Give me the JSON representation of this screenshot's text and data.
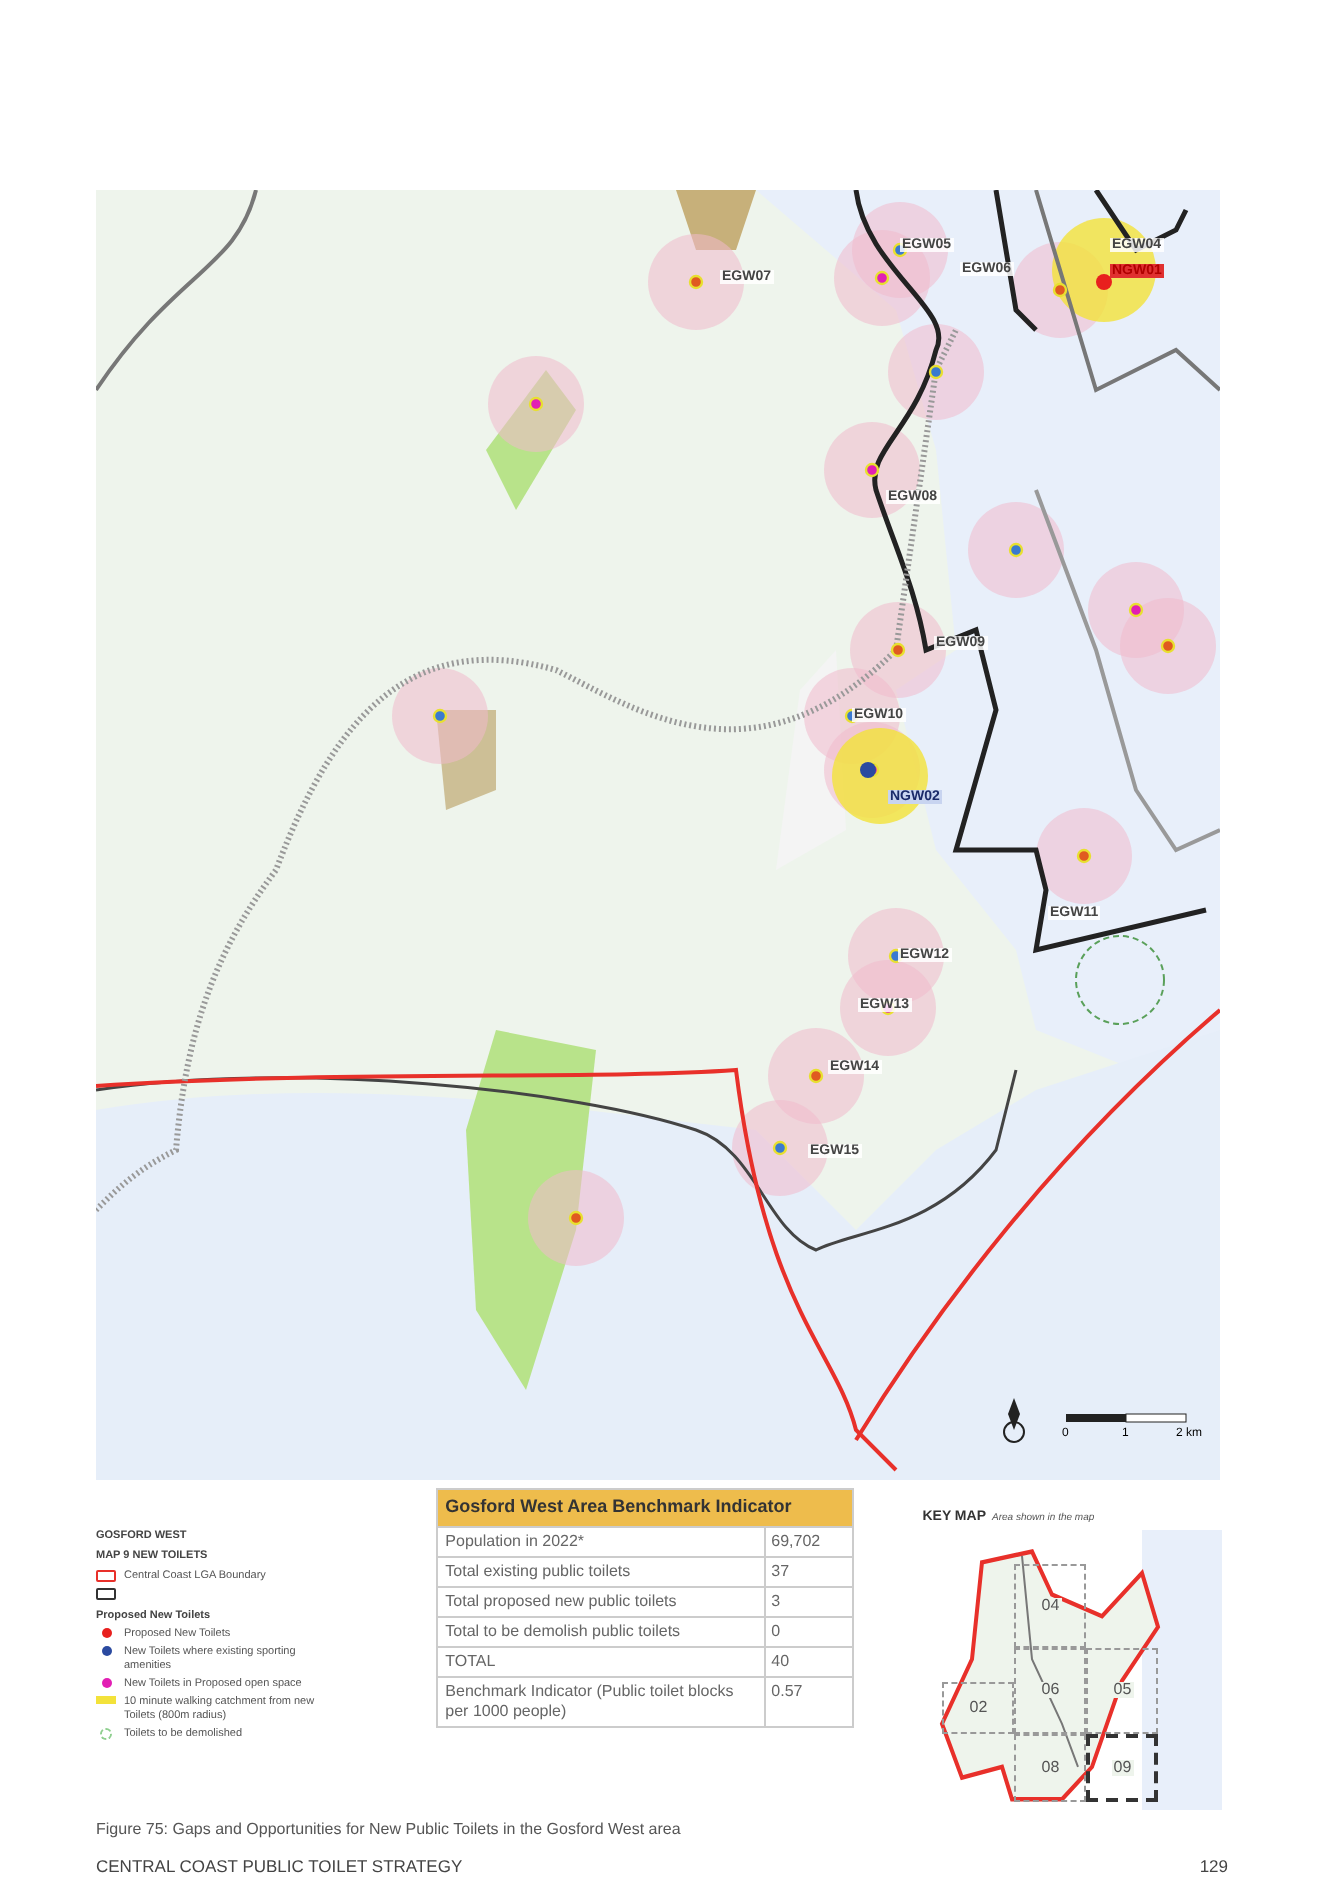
{
  "map": {
    "labels": [
      {
        "text": "EGW07",
        "kind": "existing"
      },
      {
        "text": "EGW05",
        "kind": "existing"
      },
      {
        "text": "EGW06",
        "kind": "existing"
      },
      {
        "text": "EGW04",
        "kind": "existing"
      },
      {
        "text": "NGW01",
        "kind": "new-red"
      },
      {
        "text": "EGW08",
        "kind": "existing"
      },
      {
        "text": "EGW09",
        "kind": "existing"
      },
      {
        "text": "EGW10",
        "kind": "existing"
      },
      {
        "text": "NGW02",
        "kind": "new-blue"
      },
      {
        "text": "EGW11",
        "kind": "existing"
      },
      {
        "text": "EGW12",
        "kind": "existing"
      },
      {
        "text": "EGW13",
        "kind": "existing"
      },
      {
        "text": "EGW14",
        "kind": "existing"
      },
      {
        "text": "EGW15",
        "kind": "existing"
      }
    ],
    "scale": {
      "zero": "0",
      "one": "1",
      "end": "2 km"
    }
  },
  "legend": {
    "title": "GOSFORD WEST",
    "subtitle": "MAP 9 NEW TOILETS",
    "items": [
      {
        "kind": "outline",
        "color": "#e8302a",
        "label": "Central Coast LGA Boundary"
      },
      {
        "kind": "outline",
        "color": "#333333"
      },
      {
        "kind": "heading",
        "label": "Proposed New Toilets"
      },
      {
        "kind": "dot",
        "color": "#e8201e",
        "label": "Proposed New Toilets"
      },
      {
        "kind": "dot",
        "color": "#2b4aa0",
        "label": "New Toilets where existing sporting amenities"
      },
      {
        "kind": "dot",
        "color": "#e21fb4",
        "label": "New Toilets in Proposed open space"
      },
      {
        "kind": "catchment",
        "color": "#f3e23a",
        "label": "10 minute walking catchment from new Toilets (800m radius)"
      },
      {
        "kind": "demolish",
        "color": "#8fcf8f",
        "label": "Toilets to be demolished"
      }
    ]
  },
  "table": {
    "title": "Gosford West Area Benchmark Indicator",
    "rows": [
      {
        "label": "Population in 2022*",
        "value": "69,702"
      },
      {
        "label": "Total existing public toilets",
        "value": "37"
      },
      {
        "label": "Total proposed new public toilets",
        "value": "3"
      },
      {
        "label": "Total to be demolish public toilets",
        "value": "0"
      },
      {
        "label": "TOTAL",
        "value": "40"
      },
      {
        "label": "Benchmark Indicator (Public toilet blocks per 1000 people)",
        "value": "0.57"
      }
    ]
  },
  "key_map": {
    "title": "KEY MAP",
    "subtitle": "Area shown in the map",
    "areas": [
      {
        "text": "04",
        "selected": false
      },
      {
        "text": "06",
        "selected": false
      },
      {
        "text": "05",
        "selected": false
      },
      {
        "text": "02",
        "selected": false
      },
      {
        "text": "08",
        "selected": false
      },
      {
        "text": "09",
        "selected": true
      }
    ]
  },
  "caption": "Figure 75: Gaps and Opportunities for New Public Toilets in the Gosford West area",
  "footer": {
    "title": "CENTRAL COAST PUBLIC TOILET STRATEGY",
    "page": "129"
  }
}
